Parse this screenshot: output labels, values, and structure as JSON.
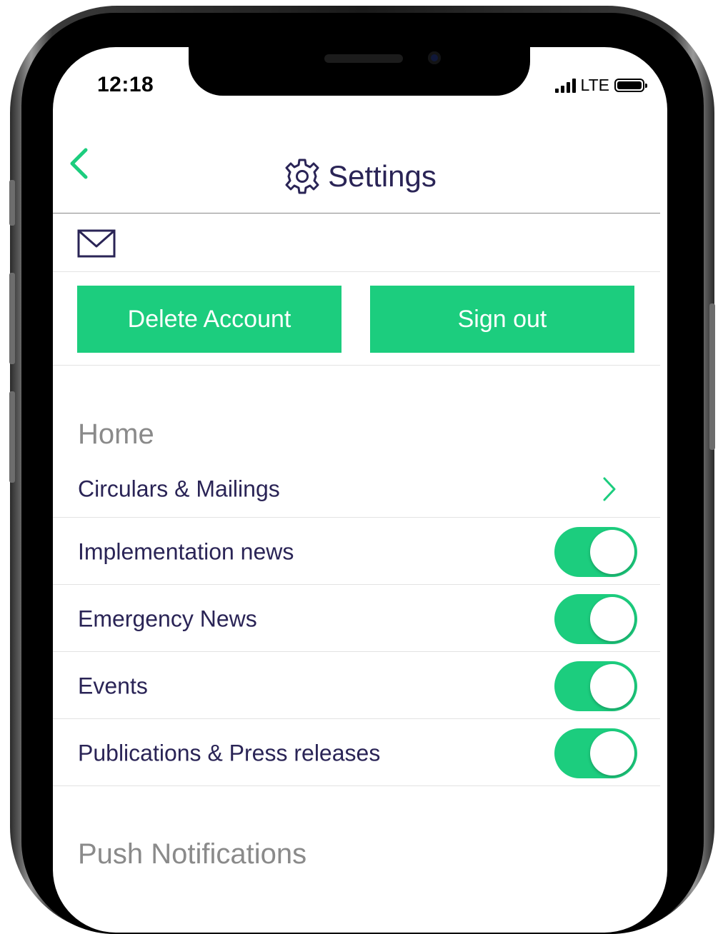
{
  "status": {
    "time": "12:18",
    "network": "LTE"
  },
  "header": {
    "title": "Settings",
    "back_icon": "chevron-left-icon",
    "title_icon": "gear-icon"
  },
  "account": {
    "mail_icon": "envelope-icon",
    "delete_label": "Delete Account",
    "signout_label": "Sign out"
  },
  "home": {
    "heading": "Home",
    "items": [
      {
        "label": "Circulars & Mailings",
        "type": "link"
      },
      {
        "label": "Implementation news",
        "type": "toggle",
        "on": true
      },
      {
        "label": "Emergency News",
        "type": "toggle",
        "on": true
      },
      {
        "label": "Events",
        "type": "toggle",
        "on": true
      },
      {
        "label": "Publications & Press releases",
        "type": "toggle",
        "on": true
      }
    ]
  },
  "push": {
    "heading": "Push Notifications"
  },
  "colors": {
    "accent": "#1ccd7e",
    "text": "#2a2456",
    "muted": "#8a8a8a"
  }
}
